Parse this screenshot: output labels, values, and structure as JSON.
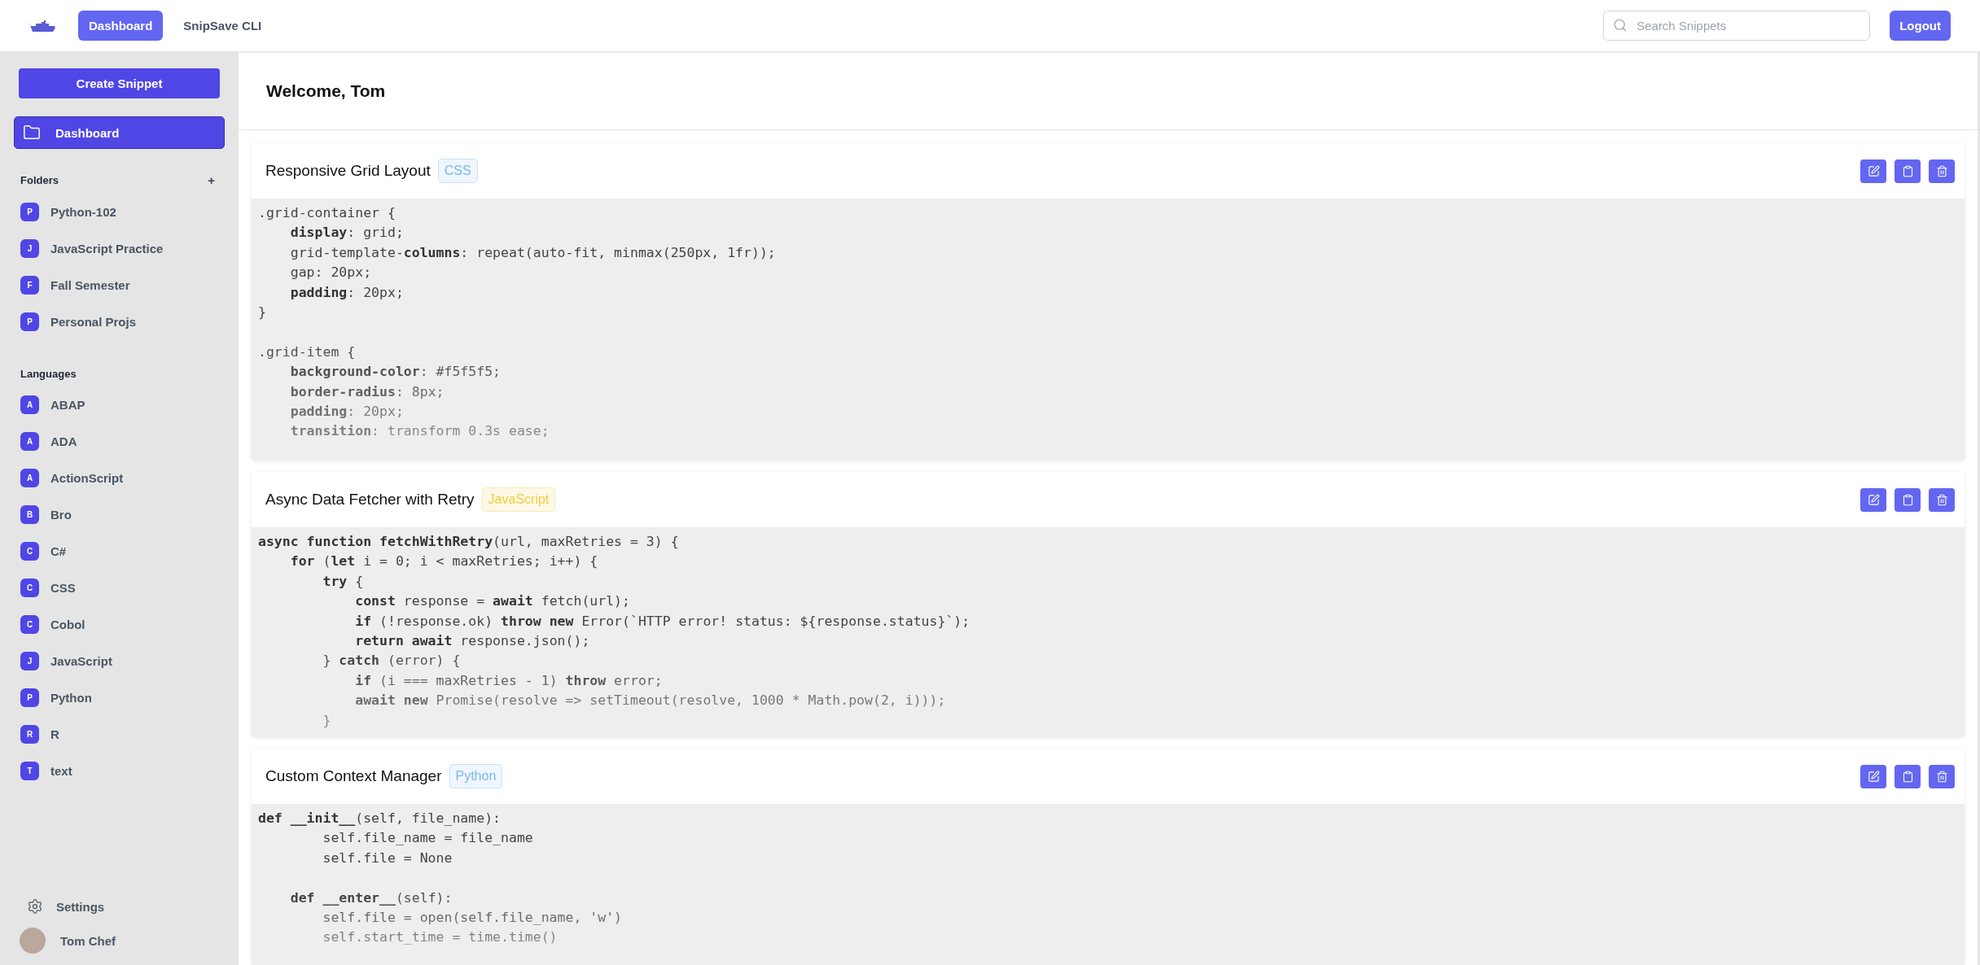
{
  "topbar": {
    "nav": [
      {
        "label": "Dashboard",
        "selected": true
      },
      {
        "label": "SnipSave CLI",
        "selected": false
      }
    ],
    "search": {
      "placeholder": "Search Snippets"
    },
    "logout": "Logout"
  },
  "sidebar": {
    "create_button": "Create Snippet",
    "main_nav": [
      {
        "label": "Dashboard",
        "selected": true
      }
    ],
    "sections": [
      {
        "title": "Folders",
        "add": "+",
        "items": [
          {
            "letter": "P",
            "label": "Python-102",
            "selected": false
          },
          {
            "letter": "J",
            "label": "JavaScript Practice",
            "selected": false
          },
          {
            "letter": "F",
            "label": "Fall Semester",
            "selected": false
          },
          {
            "letter": "P",
            "label": "Personal Projs",
            "selected": false
          }
        ]
      },
      {
        "title": "Languages",
        "items": [
          {
            "letter": "A",
            "label": "ABAP",
            "selected": false
          },
          {
            "letter": "A",
            "label": "ADA",
            "selected": false
          },
          {
            "letter": "A",
            "label": "ActionScript",
            "selected": false
          },
          {
            "letter": "B",
            "label": "Bro",
            "selected": false
          },
          {
            "letter": "C",
            "label": "C#",
            "selected": false
          },
          {
            "letter": "C",
            "label": "CSS",
            "selected": false
          },
          {
            "letter": "C",
            "label": "Cobol",
            "selected": false
          },
          {
            "letter": "J",
            "label": "JavaScript",
            "selected": false
          },
          {
            "letter": "P",
            "label": "Python",
            "selected": false
          },
          {
            "letter": "R",
            "label": "R",
            "selected": false
          },
          {
            "letter": "T",
            "label": "text",
            "selected": false
          }
        ]
      }
    ],
    "settings": "Settings",
    "user": {
      "name": "Tom Chef"
    }
  },
  "welcome": "Welcome, Tom",
  "snippets": [
    {
      "title": "Responsive Grid Layout",
      "tag": {
        "label": "CSS",
        "color": "#7ab8ee"
      },
      "code": ".grid-container {\n    **display**: grid;\n    grid-template-**columns**: repeat(auto-fit, minmax(250px, 1fr));\n    gap: 20px;\n    **padding**: 20px;\n}\n\n.grid-item {\n    **background-color**: #f5f5f5;\n    **border-radius**: 8px;\n    **padding**: 20px;\n    **transition**: transform 0.3s ease;"
    },
    {
      "title": "Async Data Fetcher with Retry",
      "tag": {
        "label": "JavaScript",
        "color": "#f2cc3c"
      },
      "code": "**async function fetchWithRetry**(url, maxRetries = 3) {\n    **for** (**let** i = 0; i < maxRetries; i++) {\n        **try** {\n            **const** response = **await** fetch(url);\n            **if** (!response.ok) **throw new** Error(`HTTP error! status: ${response.status}`);\n            **return await** response.json();\n        } **catch** (error) {\n            **if** (i === maxRetries - 1) **throw** error;\n            **await new** Promise(resolve => setTimeout(resolve, 1000 * Math.pow(2, i)));\n        }"
    },
    {
      "title": "Custom Context Manager",
      "tag": {
        "label": "Python",
        "color": "#7ab8ee"
      },
      "code": "**def __init__**(self, file_name):\n        self.file_name = file_name\n        self.file = None\n\n    **def __enter__**(self):\n        self.file = open(self.file_name, 'w')\n        self.start_time = time.time()"
    }
  ]
}
